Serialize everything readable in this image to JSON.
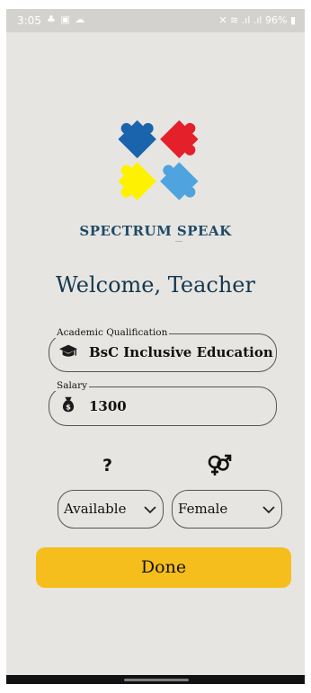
{
  "status_bar": {
    "time": "3:05",
    "left_icons": [
      "notification-icon",
      "image-icon",
      "cloud-icon"
    ],
    "right_icons": [
      "mute-icon",
      "wifi-icon",
      "signal-icon",
      "signal-icon"
    ],
    "battery": "96%"
  },
  "app": {
    "brand": "SPECTRUM SPEAK",
    "welcome": "Welcome, Teacher",
    "puzzle_colors": [
      "#e4202a",
      "#1a64ad",
      "#4fa3de",
      "#fff200"
    ]
  },
  "form": {
    "qualification": {
      "legend": "Academic Qualification",
      "value": "BsC Inclusive Education",
      "icon": "graduation-cap-icon"
    },
    "salary": {
      "legend": "Salary",
      "value": "1300",
      "icon": "money-bag-icon"
    },
    "availability_label": "?",
    "gender_icon": "gender-icon",
    "availability_select": {
      "value": "Available"
    },
    "gender_select": {
      "value": "Female"
    },
    "done_label": "Done"
  },
  "colors": {
    "accent": "#f5be1c",
    "title": "#14384e",
    "background": "#e7e5e1"
  }
}
